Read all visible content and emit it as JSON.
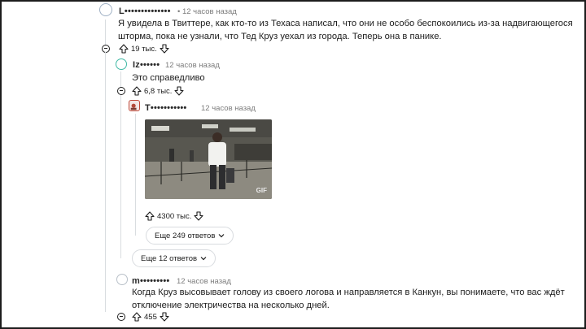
{
  "comments": [
    {
      "username": "L••••••••••••••",
      "time": "• 12 часов назад",
      "text_line1": "Я увидела в Твиттере, как кто-то из Техаса написал, что они не особо беспокоились из-за надвигающегося",
      "text_line2": "шторма, пока не узнали, что Тед Круз уехал из города. Теперь она в панике.",
      "votes": "19 тыс."
    },
    {
      "username": "Iz••••••",
      "time": "12 часов назад",
      "text": "Это справедливо",
      "votes": "6,8 тыс."
    },
    {
      "username": "T•••••••••••",
      "time": "12 часов назад",
      "gif_label": "GIF",
      "votes": "4300 тыс.",
      "more_replies": "Еще 249 ответов"
    },
    {
      "more_replies": "Еще 12 ответов"
    },
    {
      "username": "m•••••••••",
      "time": "12 часов назад",
      "text_line1": "Когда Круз высовывает голову из своего логова и направляется в Канкун, вы понимаете, что вас ждёт",
      "text_line2": "отключение электричества на несколько дней.",
      "votes": "455"
    }
  ],
  "icons": {
    "upvote": "upvote-arrow-icon",
    "downvote": "downvote-arrow-icon",
    "collapse": "collapse-minus-icon",
    "chevron": "chevron-down-icon"
  },
  "colors": {
    "thread_line": "#d9dde0",
    "text": "#1c1c1c",
    "meta": "#7c7c7c"
  }
}
